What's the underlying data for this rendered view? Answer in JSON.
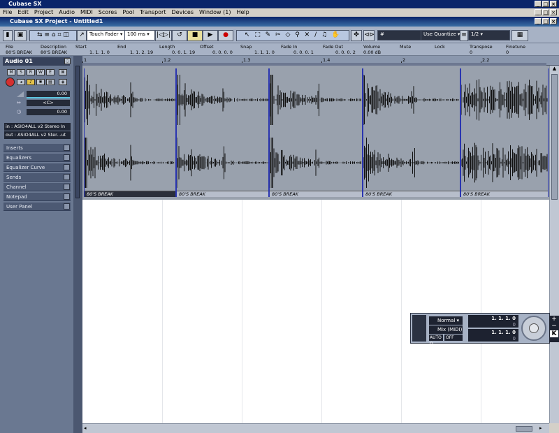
{
  "app": {
    "title": "Cubase SX"
  },
  "menu": [
    "File",
    "Edit",
    "Project",
    "Audio",
    "MIDI",
    "Scores",
    "Pool",
    "Transport",
    "Devices",
    "Window (1)",
    "Help"
  ],
  "project": {
    "title": "Cubase SX Project - Untitled1"
  },
  "toolbar": {
    "automation_mode": "Touch Fader",
    "nudge": "100 ms",
    "snap_mode": "Use Quantize",
    "quantize": "1/2"
  },
  "infoline": {
    "headers": [
      "File",
      "Description",
      "Start",
      "End",
      "Length",
      "Offset",
      "Snap",
      "Fade In",
      "Fade Out",
      "Volume",
      "Mute",
      "Lock",
      "Transpose",
      "Finetune"
    ],
    "values": [
      "80'S BREAK",
      "80'S BREAK",
      "1. 1. 1.  0",
      "1. 1. 2. 19",
      "0. 0. 1. 19",
      "0. 0. 0.  0",
      "1. 1. 1.  0",
      "0. 0. 0.  1",
      "0. 0. 0.  2",
      "0.00 dB",
      "",
      "",
      "0",
      "0"
    ]
  },
  "inspector": {
    "track_name": "Audio 01",
    "buttons": [
      "M",
      "S",
      "R",
      "W",
      "E"
    ],
    "volume": "0.00",
    "pan": "<C>",
    "delay": "0.00",
    "input": "in : ASIO4ALL v2 Stereo In",
    "output": "out : ASIO4ALL v2 Ster...ut",
    "sections": [
      "Inserts",
      "Equalizers",
      "Equalizer Curve",
      "Sends",
      "Channel",
      "Notepad",
      "User Panel"
    ]
  },
  "ruler": {
    "marks": [
      "1",
      "1.2",
      "1.3",
      "1.4",
      "2",
      "2.2"
    ]
  },
  "events": [
    {
      "label": "80'S BREAK",
      "selected": true
    },
    {
      "label": "80'S BREAK",
      "selected": false
    },
    {
      "label": "80'S BREAK",
      "selected": false
    },
    {
      "label": "80'S BREAK",
      "selected": false
    },
    {
      "label": "80'S BREAK",
      "selected": false
    }
  ],
  "transport": {
    "mode": "Normal",
    "mix": "Mix (MIDI)",
    "auto_label": "AUTO Q",
    "auto_value": "OFF",
    "left_locator": "1. 1. 1.  0",
    "right_locator": "1. 1. 1.  0",
    "left_small": "0",
    "right_small": "0"
  }
}
